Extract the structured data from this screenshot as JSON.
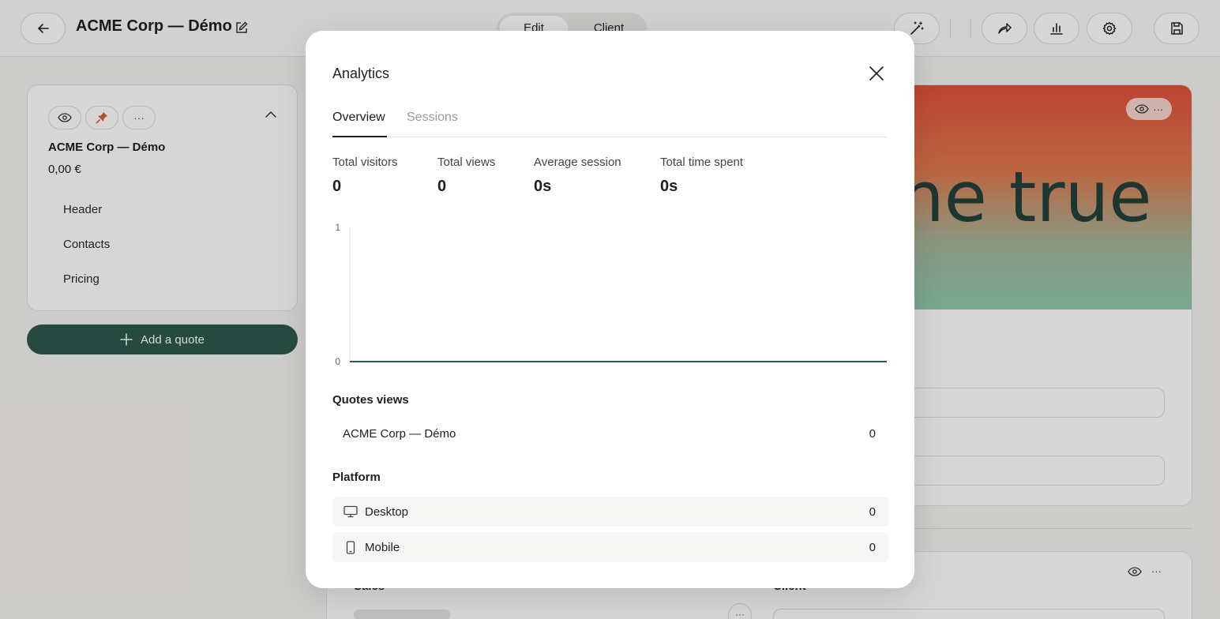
{
  "topbar": {
    "title": "ACME Corp — Démo",
    "mode_edit": "Edit",
    "mode_client": "Client"
  },
  "sidebar": {
    "quote_title": "ACME Corp — Démo",
    "quote_price": "0,00 €",
    "sections": [
      "Header",
      "Contacts",
      "Pricing"
    ],
    "add_quote_label": "Add a quote",
    "chip_more": "···"
  },
  "editor": {
    "cover_text": "ne true",
    "bottom_left_label": "Sales",
    "bottom_right_label": "Client",
    "more_glyph": "···"
  },
  "modal": {
    "title": "Analytics",
    "tabs": [
      {
        "label": "Overview",
        "active": true
      },
      {
        "label": "Sessions",
        "active": false
      }
    ],
    "metrics": [
      {
        "label": "Total visitors",
        "value": "0"
      },
      {
        "label": "Total views",
        "value": "0"
      },
      {
        "label": "Average session",
        "value": "0s"
      },
      {
        "label": "Total time spent",
        "value": "0s"
      }
    ],
    "quotes_views": {
      "heading": "Quotes views",
      "rows": [
        {
          "label": "ACME Corp — Démo",
          "value": "0"
        }
      ]
    },
    "platform": {
      "heading": "Platform",
      "rows": [
        {
          "label": "Desktop",
          "value": "0",
          "icon": "monitor-icon"
        },
        {
          "label": "Mobile",
          "value": "0",
          "icon": "mobile-icon"
        }
      ]
    }
  },
  "chart_data": {
    "type": "line",
    "y_ticks": [
      "1",
      "0"
    ],
    "ylim": [
      0,
      1
    ],
    "series": [
      {
        "values": [
          0,
          0
        ]
      }
    ],
    "line_color": "#2d5a4e",
    "grid": false
  },
  "colors": {
    "accent": "#2d5a4e",
    "pin": "#d4622f"
  }
}
